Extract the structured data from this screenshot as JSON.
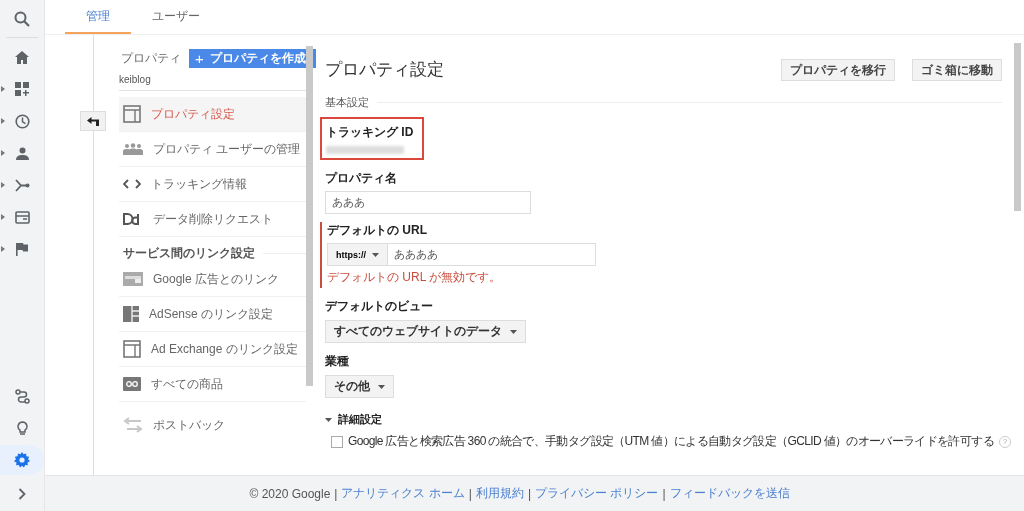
{
  "rail": {
    "items": [
      {
        "expandable": false
      },
      {
        "expandable": true
      },
      {
        "expandable": true
      },
      {
        "expandable": true
      },
      {
        "expandable": true
      },
      {
        "expandable": true
      },
      {
        "expandable": true
      }
    ],
    "bottom_items": [
      {
        "selected": false
      },
      {
        "selected": false
      },
      {
        "selected": true
      }
    ]
  },
  "tabs": [
    {
      "label": "管理",
      "selected": true
    },
    {
      "label": "ユーザー",
      "selected": false
    }
  ],
  "property_column": {
    "label": "プロパティ",
    "create_button": "プロパティを作成",
    "create_icon": "+",
    "account": "keiblog",
    "items": [
      {
        "label": "プロパティ設定",
        "selected": true
      },
      {
        "label": "プロパティ ユーザーの管理",
        "selected": false
      },
      {
        "label": "トラッキング情報",
        "selected": false
      },
      {
        "label": "データ削除リクエスト",
        "selected": false
      }
    ],
    "group_heading": "サービス間のリンク設定",
    "group_items": [
      {
        "label": "Google 広告とのリンク",
        "selected": false
      },
      {
        "label": "AdSense のリンク設定",
        "selected": false
      },
      {
        "label": "Ad Exchange のリンク設定",
        "selected": false
      },
      {
        "label": "すべての商品",
        "selected": false
      },
      {
        "label": "ポストバック",
        "selected": false
      }
    ]
  },
  "main": {
    "title": "プロパティ設定",
    "buttons": [
      "プロパティを移行",
      "ゴミ箱に移動"
    ],
    "section": "基本設定",
    "tracking_id": {
      "label": "トラッキング ID",
      "highlighted": true
    },
    "property_name": {
      "label": "プロパティ名",
      "value": "あああ"
    },
    "default_url": {
      "label": "デフォルトの URL",
      "protocol": "https://",
      "value": "ああああ",
      "error": true,
      "error_message": "デフォルトの URL が無効です。"
    },
    "default_view": {
      "label": "デフォルトのビュー",
      "value": "すべてのウェブサイトのデータ"
    },
    "industry": {
      "label": "業種",
      "value": "その他"
    },
    "advanced": {
      "label": "詳細設定",
      "expanded": true,
      "checkbox": {
        "label": "Google 広告と検索広告 360 の統合で、手動タグ設定（UTM 値）による自動タグ設定（GCLID 値）のオーバーライドを許可する",
        "checked": false
      },
      "help": "?"
    }
  },
  "footer": {
    "copyright": "© 2020 Google",
    "separator": "|",
    "links": [
      "アナリティクス ホーム",
      "利用規約",
      "プライバシー ポリシー",
      "フィードバックを送信"
    ]
  }
}
